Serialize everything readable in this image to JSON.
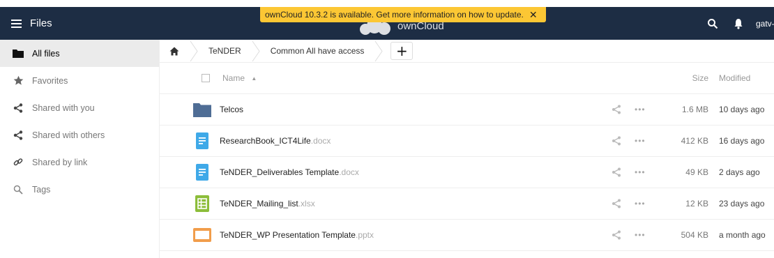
{
  "header": {
    "app_title": "Files",
    "logo_text": "ownCloud",
    "user_name": "gatv-oc",
    "brand_color": "#1d2d44"
  },
  "update_notice": {
    "text": "ownCloud 10.3.2 is available. Get more information on how to update.",
    "close_glyph": "✕",
    "color": "#fcc734"
  },
  "sidebar": {
    "items": [
      {
        "label": "All files",
        "icon": "folder-icon",
        "active": true
      },
      {
        "label": "Favorites",
        "icon": "star-icon"
      },
      {
        "label": "Shared with you",
        "icon": "share-icon"
      },
      {
        "label": "Shared with others",
        "icon": "share-icon"
      },
      {
        "label": "Shared by link",
        "icon": "link-icon"
      },
      {
        "label": "Tags",
        "icon": "tag-search-icon"
      }
    ]
  },
  "breadcrumb": {
    "home_icon": "home-icon",
    "items": [
      "TeNDER",
      "Common All have access"
    ],
    "new_label": "+"
  },
  "table": {
    "columns": {
      "name": "Name",
      "sort_glyph": "▲",
      "size": "Size",
      "modified": "Modified"
    },
    "rows": [
      {
        "name": "Telcos",
        "ext": "",
        "type": "folder",
        "size": "1.6 MB",
        "modified": "10 days ago"
      },
      {
        "name": "ResearchBook_ICT4Life",
        "ext": ".docx",
        "type": "document",
        "size": "412 KB",
        "modified": "16 days ago"
      },
      {
        "name": "TeNDER_Deliverables Template",
        "ext": ".docx",
        "type": "document",
        "size": "49 KB",
        "modified": "2 days ago"
      },
      {
        "name": "TeNDER_Mailing_list",
        "ext": ".xlsx",
        "type": "spreadsheet",
        "size": "12 KB",
        "modified": "23 days ago"
      },
      {
        "name": "TeNDER_WP Presentation Template",
        "ext": ".pptx",
        "type": "presentation",
        "size": "504 KB",
        "modified": "a month ago"
      }
    ],
    "more_glyph": "•••"
  }
}
